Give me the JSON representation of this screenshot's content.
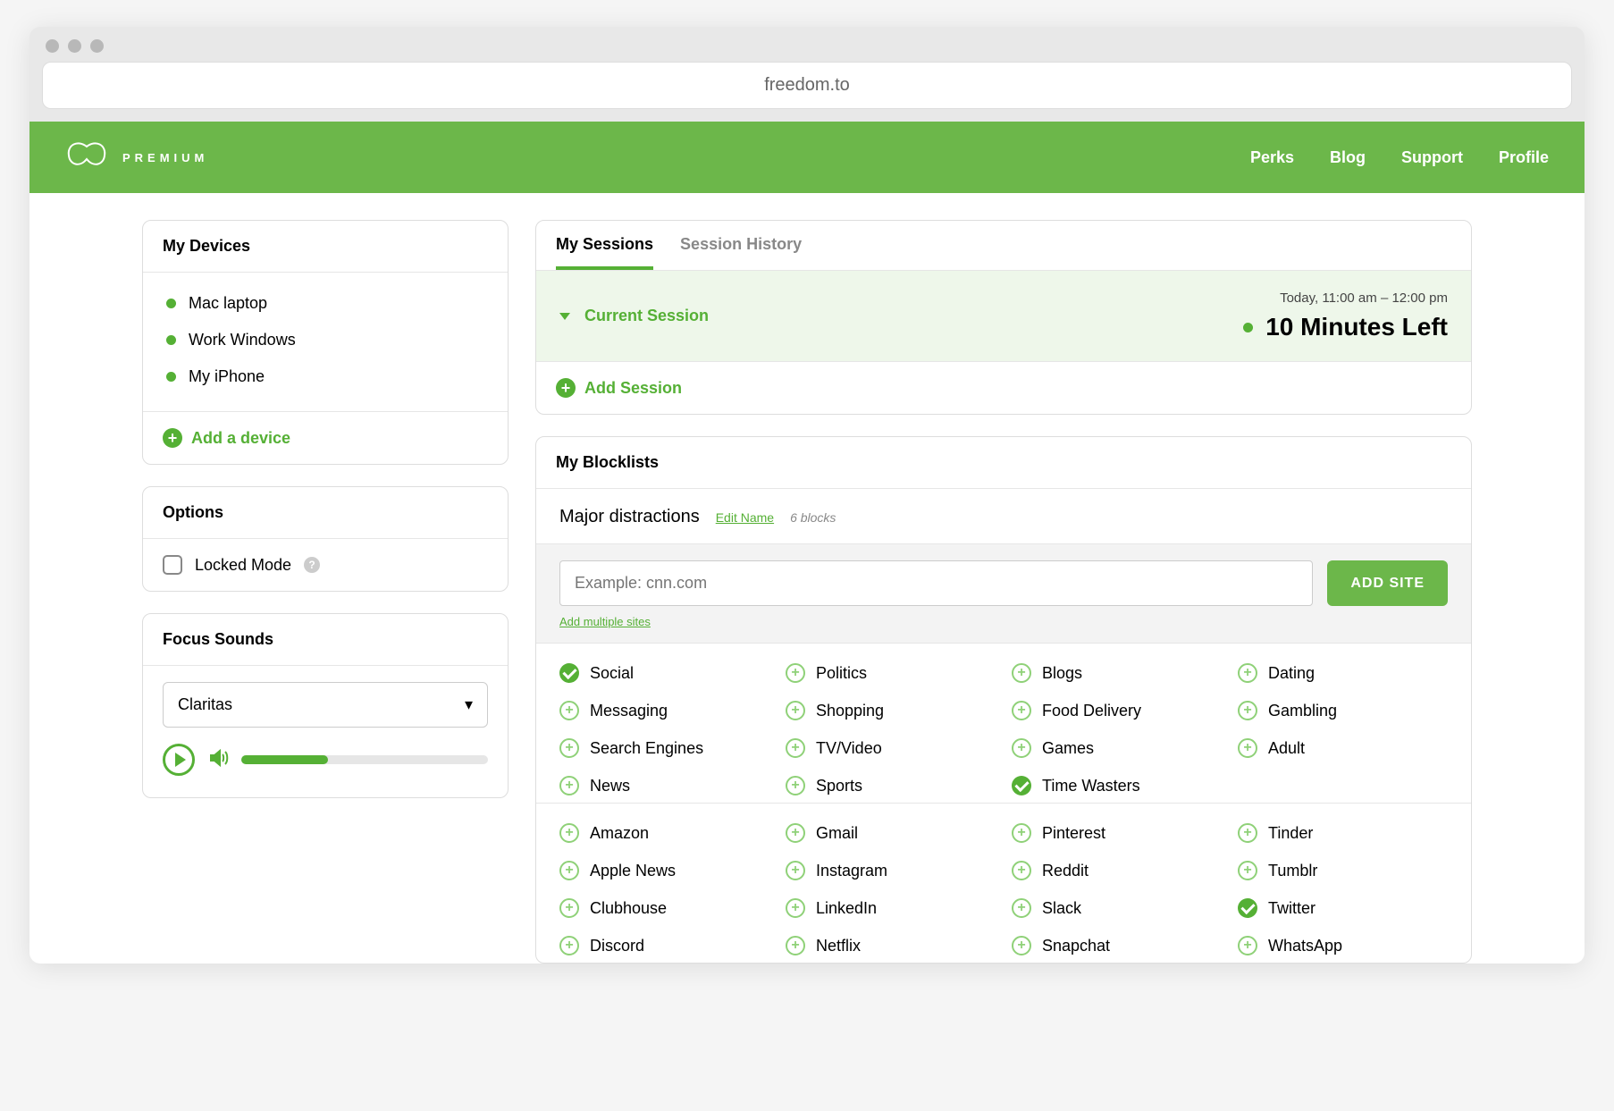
{
  "window": {
    "url": "freedom.to"
  },
  "brand": {
    "premium_label": "PREMIUM"
  },
  "nav": {
    "perks": "Perks",
    "blog": "Blog",
    "support": "Support",
    "profile": "Profile"
  },
  "devices": {
    "title": "My Devices",
    "items": [
      "Mac laptop",
      "Work Windows",
      "My iPhone"
    ],
    "add_label": "Add a device"
  },
  "options": {
    "title": "Options",
    "locked_mode_label": "Locked Mode"
  },
  "sounds": {
    "title": "Focus Sounds",
    "selected": "Claritas"
  },
  "sessions": {
    "tab_my": "My Sessions",
    "tab_history": "Session History",
    "current_label": "Current Session",
    "schedule": "Today, 11:00 am – 12:00 pm",
    "time_left": "10 Minutes Left",
    "add_label": "Add Session"
  },
  "blocklists": {
    "title": "My Blocklists",
    "list_name": "Major distractions",
    "edit_label": "Edit Name",
    "count_label": "6 blocks",
    "input_placeholder": "Example: cnn.com",
    "add_btn": "ADD SITE",
    "multi_label": "Add multiple sites",
    "categories": [
      {
        "name": "Social",
        "checked": true
      },
      {
        "name": "Politics",
        "checked": false
      },
      {
        "name": "Blogs",
        "checked": false
      },
      {
        "name": "Dating",
        "checked": false
      },
      {
        "name": "Messaging",
        "checked": false
      },
      {
        "name": "Shopping",
        "checked": false
      },
      {
        "name": "Food Delivery",
        "checked": false
      },
      {
        "name": "Gambling",
        "checked": false
      },
      {
        "name": "Search Engines",
        "checked": false
      },
      {
        "name": "TV/Video",
        "checked": false
      },
      {
        "name": "Games",
        "checked": false
      },
      {
        "name": "Adult",
        "checked": false
      },
      {
        "name": "News",
        "checked": false
      },
      {
        "name": "Sports",
        "checked": false
      },
      {
        "name": "Time Wasters",
        "checked": true
      }
    ],
    "sites": [
      {
        "name": "Amazon",
        "checked": false
      },
      {
        "name": "Gmail",
        "checked": false
      },
      {
        "name": "Pinterest",
        "checked": false
      },
      {
        "name": "Tinder",
        "checked": false
      },
      {
        "name": "Apple News",
        "checked": false
      },
      {
        "name": "Instagram",
        "checked": false
      },
      {
        "name": "Reddit",
        "checked": false
      },
      {
        "name": "Tumblr",
        "checked": false
      },
      {
        "name": "Clubhouse",
        "checked": false
      },
      {
        "name": "LinkedIn",
        "checked": false
      },
      {
        "name": "Slack",
        "checked": false
      },
      {
        "name": "Twitter",
        "checked": true
      },
      {
        "name": "Discord",
        "checked": false
      },
      {
        "name": "Netflix",
        "checked": false
      },
      {
        "name": "Snapchat",
        "checked": false
      },
      {
        "name": "WhatsApp",
        "checked": false
      }
    ]
  }
}
